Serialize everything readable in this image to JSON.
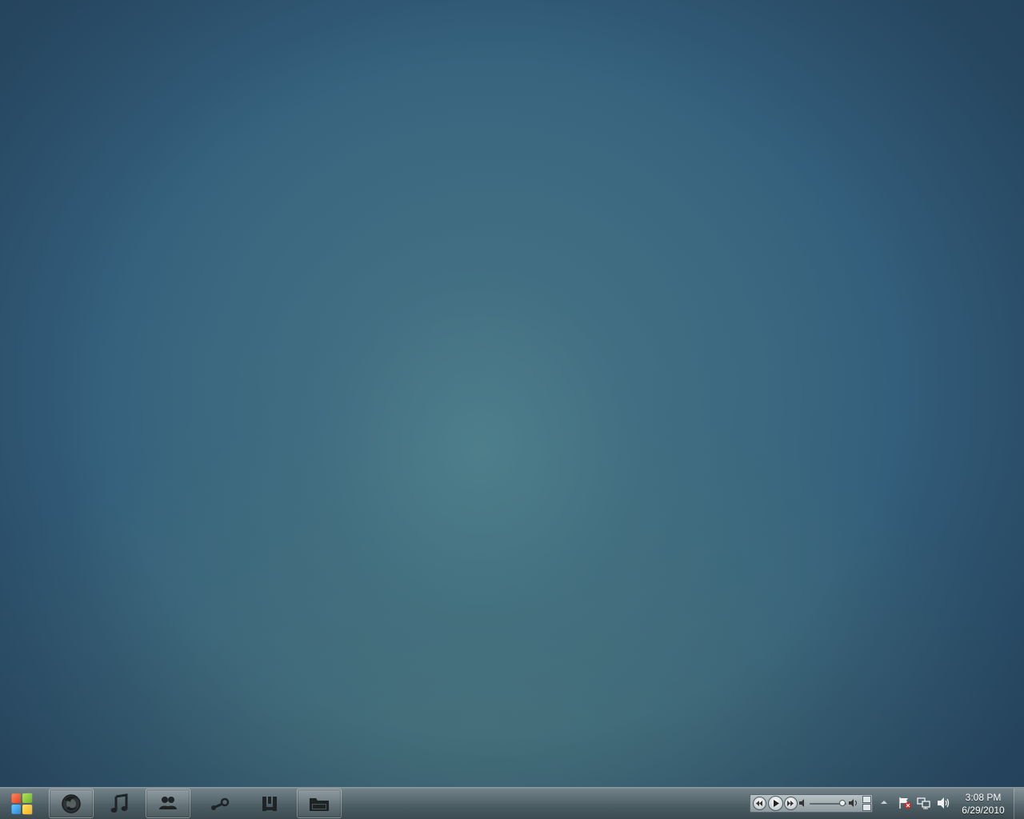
{
  "desktop": {
    "wallpaper_colors": {
      "center": "#4f808a",
      "edge": "#2c4f6b",
      "bottom": "#4b706f"
    }
  },
  "taskbar": {
    "start_button_icon": "windows-logo-icon",
    "pinned_apps": [
      {
        "name": "firefox",
        "icon": "firefox-icon",
        "active": true
      },
      {
        "name": "music",
        "icon": "music-note-icon",
        "active": false
      },
      {
        "name": "contacts",
        "icon": "people-icon",
        "active": true
      },
      {
        "name": "steam",
        "icon": "steam-icon",
        "active": false
      },
      {
        "name": "utorrent",
        "icon": "utorrent-icon",
        "active": false
      },
      {
        "name": "explorer",
        "icon": "folder-icon",
        "active": true
      }
    ],
    "media_player": {
      "buttons": [
        "previous-icon",
        "play-icon",
        "next-icon"
      ],
      "volume_level": 0.9
    },
    "tray_icons": [
      "show-hidden-icons-arrow-icon",
      "action-center-flag-icon",
      "network-icon",
      "speaker-icon"
    ],
    "clock": {
      "time": "3:08 PM",
      "date": "6/29/2010"
    }
  }
}
